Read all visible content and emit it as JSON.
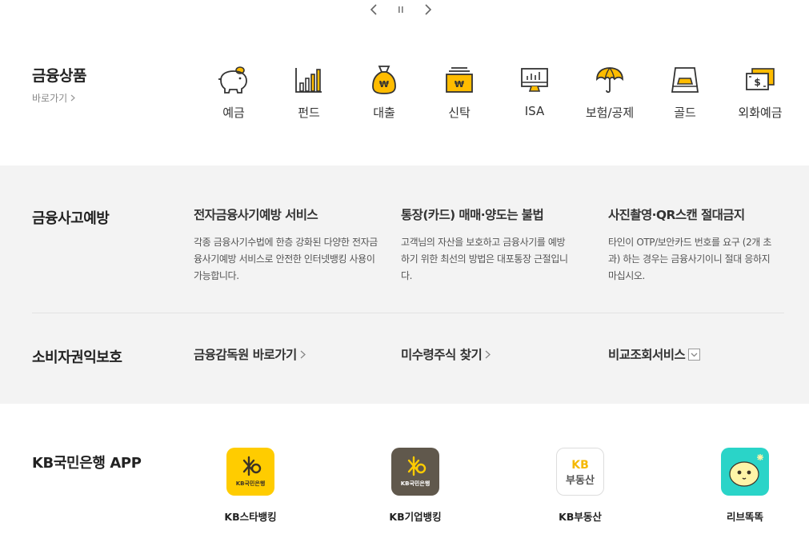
{
  "carousel": {
    "prev_icon": "chevron-left-icon",
    "pause_icon": "pause-icon",
    "next_icon": "chevron-right-icon"
  },
  "products": {
    "title": "금융상품",
    "shortcut_label": "바로가기",
    "items": [
      {
        "label": "예금",
        "icon": "piggy-bank-icon"
      },
      {
        "label": "펀드",
        "icon": "bar-chart-icon"
      },
      {
        "label": "대출",
        "icon": "money-bag-icon"
      },
      {
        "label": "신탁",
        "icon": "trust-box-icon"
      },
      {
        "label": "ISA",
        "icon": "monitor-chart-icon"
      },
      {
        "label": "보험/공제",
        "icon": "umbrella-icon"
      },
      {
        "label": "골드",
        "icon": "gold-bar-icon"
      },
      {
        "label": "외화예금",
        "icon": "foreign-currency-icon"
      }
    ]
  },
  "fraud_prevention": {
    "title": "금융사고예방",
    "notices": [
      {
        "title": "전자금융사기예방 서비스",
        "desc": "각종 금융사기수법에 한층 강화된 다양한 전자금융사기예방 서비스로 안전한 인터넷뱅킹 사용이 가능합니다."
      },
      {
        "title": "통장(카드) 매매·양도는 불법",
        "desc": "고객님의 자산을 보호하고 금융사기를 예방하기 위한 최선의 방법은 대포통장 근절입니다."
      },
      {
        "title": "사진촬영·QR스캔 절대금지",
        "desc": "타인이 OTP/보안카드 번호를 요구 (2개 초과) 하는 경우는 금융사기이니 절대 응하지 마십시오."
      }
    ]
  },
  "consumer_protection": {
    "title": "소비자권익보호",
    "links": [
      {
        "label": "금융감독원 바로가기",
        "icon": "chevron-right-icon"
      },
      {
        "label": "미수령주식 찾기",
        "icon": "chevron-right-icon"
      },
      {
        "label": "비교조회서비스",
        "icon": "dropdown-box-icon"
      }
    ]
  },
  "kb_app": {
    "title": "KB국민은행 APP",
    "apps": [
      {
        "name": "KB스타뱅킹",
        "icon_text": "KB국민은행",
        "color": "#ffcc00"
      },
      {
        "name": "KB기업뱅킹",
        "icon_text": "KB국민은행",
        "color": "#60584c"
      },
      {
        "name": "KB부동산",
        "icon_text_top": "KB",
        "icon_text_bottom": "부동산",
        "color": "#ffffff"
      },
      {
        "name": "리브똑똑",
        "color": "#2ad4c8"
      }
    ]
  },
  "colors": {
    "accent_yellow": "#ffbc00",
    "icon_stroke": "#333333",
    "band_bg": "#f3f3f3"
  }
}
